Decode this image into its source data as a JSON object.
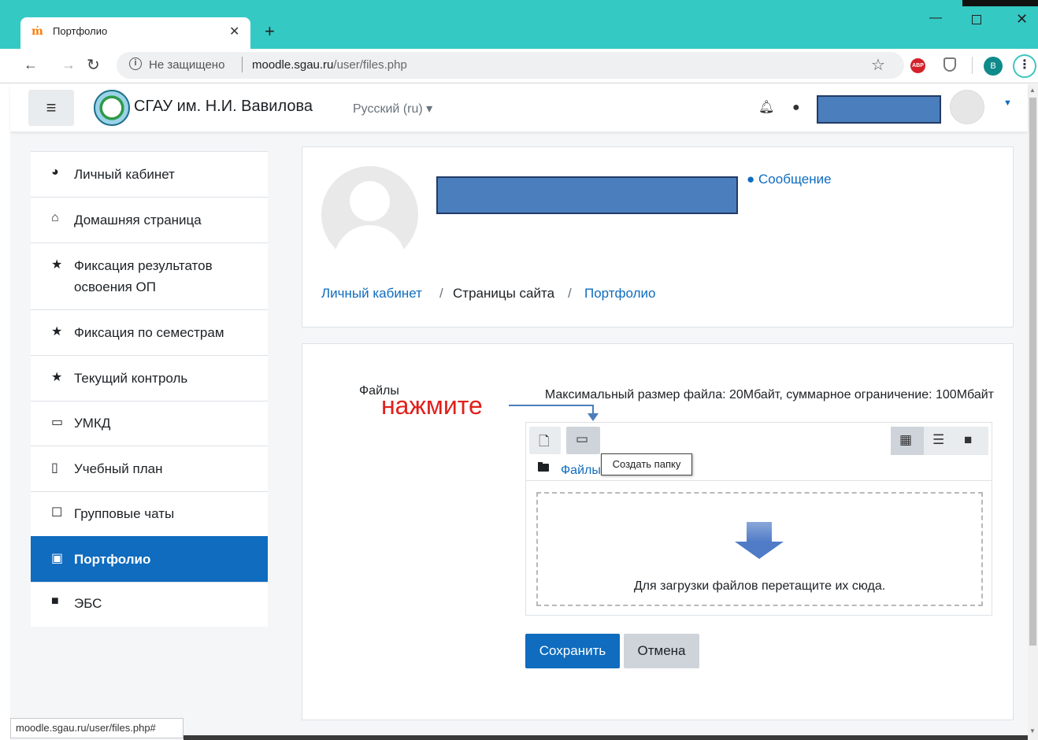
{
  "browser": {
    "tab_title": "Портфолио",
    "tab_favicon": "moodle-icon",
    "security_label": "Не защищено",
    "url_host": "moodle.sgau.ru",
    "url_path": "/user/files.php",
    "profile_initial": "B",
    "status_url": "moodle.sgau.ru/user/files.php#"
  },
  "site": {
    "name": "СГАУ им. Н.И. Вавилова",
    "language": "Русский (ru)"
  },
  "sidebar": {
    "items": [
      {
        "label": "Личный кабинет",
        "icon": "dashboard-icon"
      },
      {
        "label": "Домашняя страница",
        "icon": "home-icon"
      },
      {
        "label": "Фиксация результатов освоения ОП",
        "icon": "star-icon"
      },
      {
        "label": "Фиксация по семестрам",
        "icon": "star-icon"
      },
      {
        "label": "Текущий контроль",
        "icon": "star-icon"
      },
      {
        "label": "УМКД",
        "icon": "laptop-icon"
      },
      {
        "label": "Учебный план",
        "icon": "clipboard-icon"
      },
      {
        "label": "Групповые чаты",
        "icon": "comment-icon"
      },
      {
        "label": "Портфолио",
        "icon": "id-card-icon",
        "active": true
      },
      {
        "label": "ЭБС",
        "icon": "book-icon"
      }
    ]
  },
  "header": {
    "message_label": "Сообщение",
    "breadcrumb": [
      "Личный кабинет",
      "Страницы сайта",
      "Портфолио"
    ]
  },
  "form": {
    "files_label": "Файлы",
    "max_size": "Максимальный размер файла: 20Мбайт, суммарное ограничение: 100Мбайт",
    "path": "Файлы",
    "tooltip": "Создать папку",
    "drop_text": "Для загрузки файлов перетащите их сюда.",
    "save_label": "Сохранить",
    "cancel_label": "Отмена"
  },
  "annotation": {
    "text": "нажмите"
  },
  "colors": {
    "tab_strip": "#35c9c4",
    "primary": "#0f6cbf",
    "annotation": "#e0201c",
    "redaction": "#4a7ebc"
  }
}
